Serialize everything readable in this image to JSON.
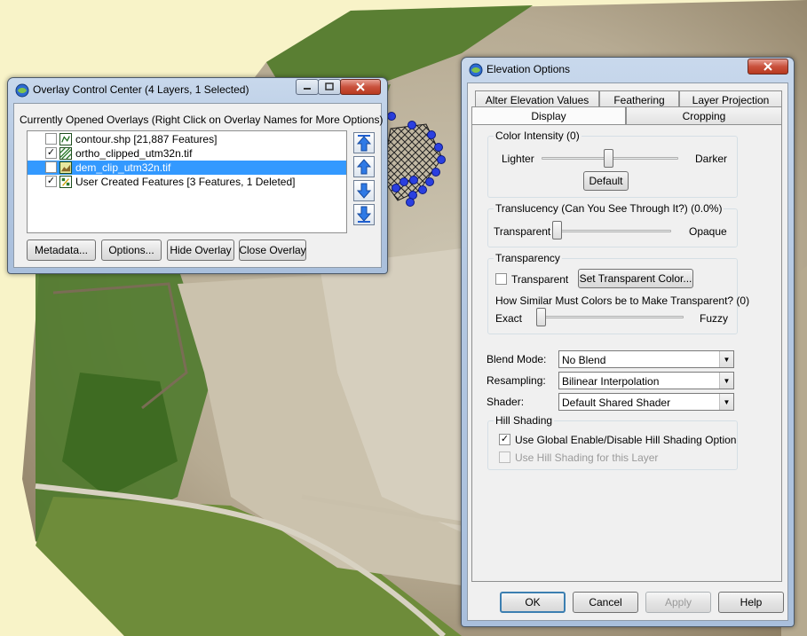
{
  "overlay_window": {
    "title": "Overlay Control Center (4 Layers, 1 Selected)",
    "header": "Currently Opened Overlays (Right Click on Overlay Names for More Options)",
    "layers": [
      {
        "name": "contour.shp [21,887 Features]",
        "checked": false,
        "selected": false,
        "icon": "vector-line-icon"
      },
      {
        "name": "ortho_clipped_utm32n.tif",
        "checked": true,
        "selected": false,
        "icon": "raster-hatch-icon"
      },
      {
        "name": "dem_clip_utm32n.tif",
        "checked": true,
        "selected": true,
        "icon": "elevation-icon"
      },
      {
        "name": "User Created Features [3 Features, 1 Deleted]",
        "checked": true,
        "selected": false,
        "icon": "user-features-icon"
      }
    ],
    "buttons": {
      "metadata": "Metadata...",
      "options": "Options...",
      "hide": "Hide Overlay",
      "close": "Close Overlay"
    }
  },
  "elevation_window": {
    "title": "Elevation Options",
    "tabs_back": [
      "Alter Elevation Values",
      "Feathering",
      "Layer Projection"
    ],
    "tabs_front": [
      "Display",
      "Cropping"
    ],
    "color_intensity": {
      "title": "Color Intensity (0)",
      "left_label": "Lighter",
      "right_label": "Darker",
      "default_button": "Default",
      "value": 0.5
    },
    "translucency": {
      "title": "Translucency (Can You See Through It?) (0.0%)",
      "left_label": "Transparent",
      "right_label": "Opaque",
      "value": 0.0
    },
    "transparency": {
      "title": "Transparency",
      "checkbox_label": "Transparent",
      "checked": false,
      "set_color_button": "Set Transparent Color...",
      "similarity_label": "How Similar Must Colors be to Make Transparent? (0)",
      "left_label": "Exact",
      "right_label": "Fuzzy",
      "value": 0.0
    },
    "blend_mode": {
      "label": "Blend Mode:",
      "value": "No Blend"
    },
    "resampling": {
      "label": "Resampling:",
      "value": "Bilinear Interpolation"
    },
    "shader": {
      "label": "Shader:",
      "value": "Default Shared Shader"
    },
    "hill_shading": {
      "title": "Hill Shading",
      "global_option": "Use Global Enable/Disable Hill Shading Option",
      "global_checked": true,
      "layer_option": "Use Hill Shading for this Layer",
      "layer_checked": false
    },
    "buttons": {
      "ok": "OK",
      "cancel": "Cancel",
      "apply": "Apply",
      "help": "Help"
    }
  },
  "colors": {
    "selection": "#3399ff",
    "vertex_marker": "#2a3fe0",
    "background_yellow": "#f8f3c8"
  }
}
